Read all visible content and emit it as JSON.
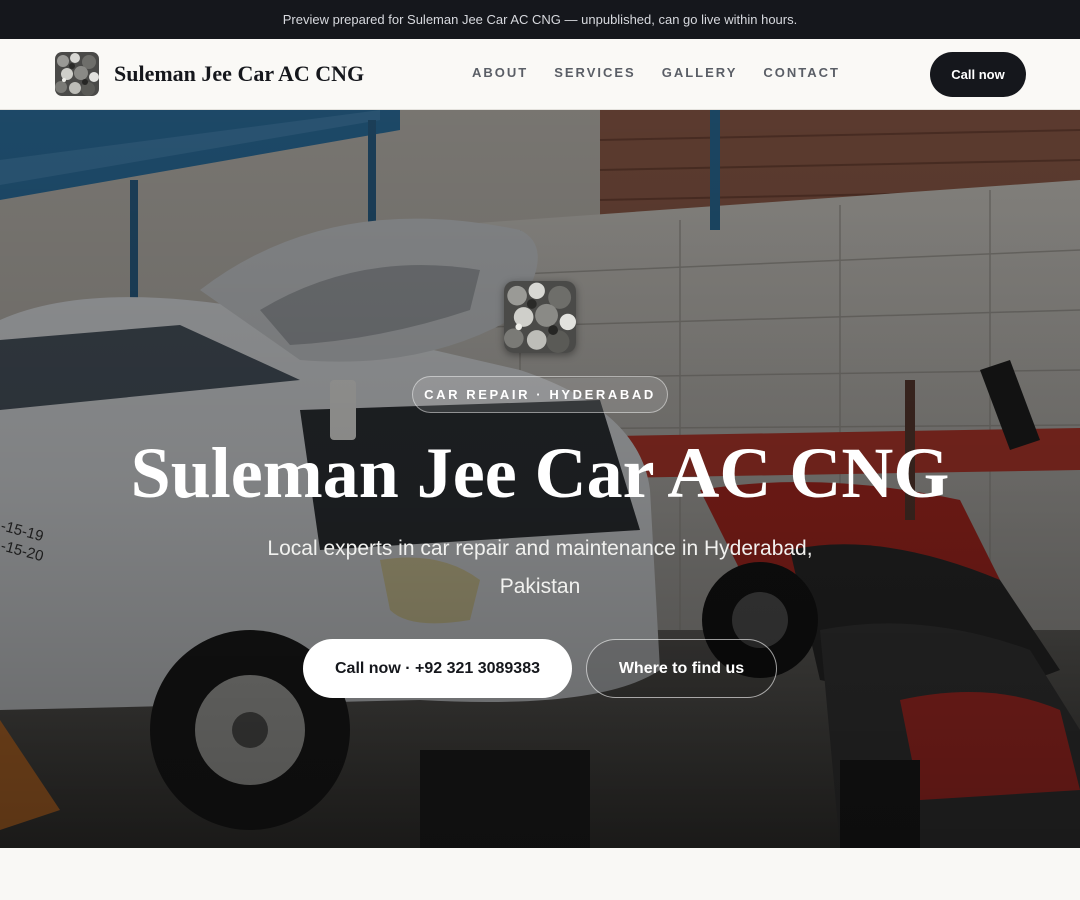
{
  "announcement": {
    "text": "Preview prepared for Suleman Jee Car AC CNG — unpublished, can go live within hours."
  },
  "header": {
    "brand_name": "Suleman Jee Car AC CNG",
    "nav": [
      {
        "label": "ABOUT"
      },
      {
        "label": "SERVICES"
      },
      {
        "label": "GALLERY"
      },
      {
        "label": "CONTACT"
      }
    ],
    "call_label": "Call now"
  },
  "hero": {
    "eyebrow": "CAR REPAIR · HYDERABAD",
    "title": "Suleman Jee Car AC CNG",
    "subtitle": "Local experts in car repair and maintenance in Hyderabad, Pakistan",
    "primary_cta": "Call now · +92 321 3089383",
    "secondary_cta": "Where to find us"
  },
  "colors": {
    "dark": "#15171c",
    "accent_red": "#c0302a",
    "background": "#f9f8f5"
  },
  "icons": {
    "logo": "crushed-metal-logo-icon"
  }
}
